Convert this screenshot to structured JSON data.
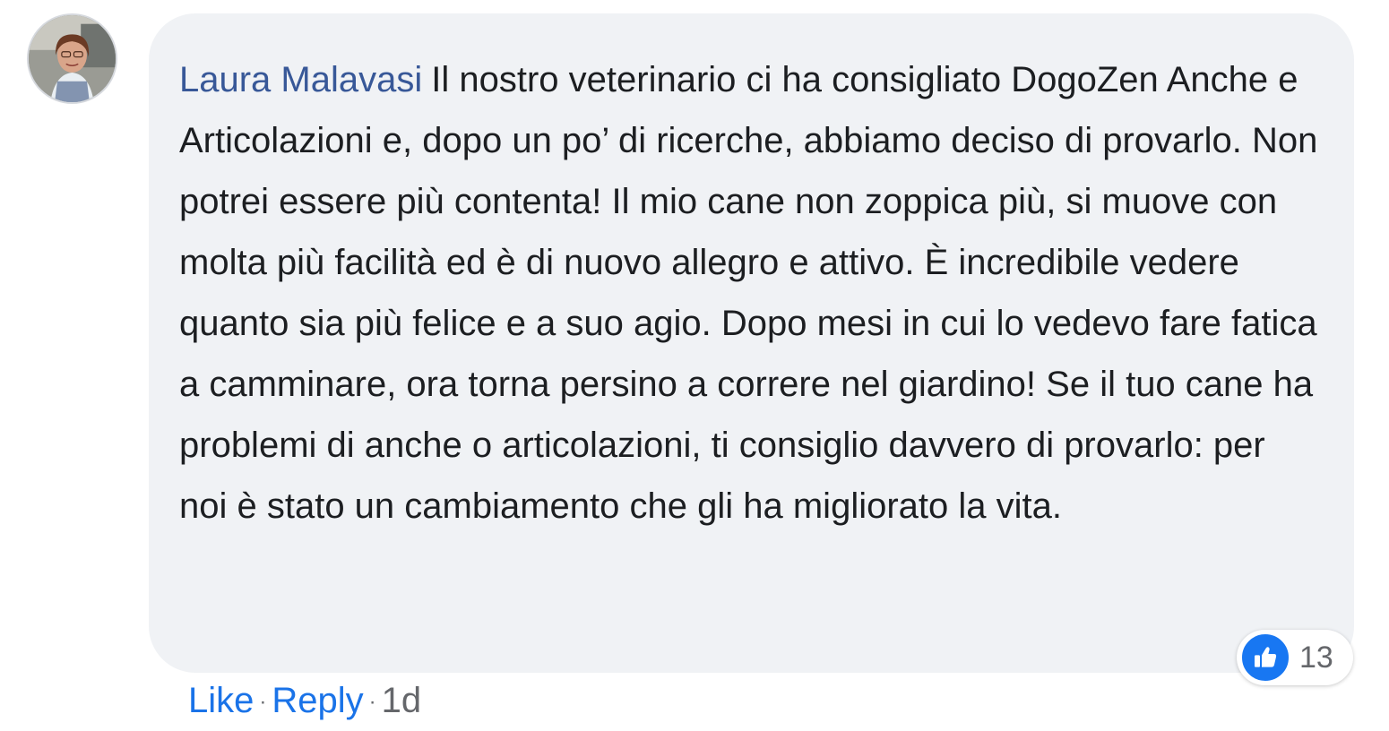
{
  "comment": {
    "author": "Laura Malavasi",
    "text": "Il nostro veterinario ci ha consigliato DogoZen Anche e Articolazioni e, dopo un po’ di ricerche, abbiamo deciso di provarlo. Non potrei essere più contenta! Il mio cane non zoppica più, si muove con molta più facilità ed è di nuovo allegro e attivo. È incredibile vedere quanto sia più felice e a suo agio. Dopo mesi in cui lo vedevo fare fatica a camminare, ora torna persino a correre nel giardino! Se il tuo cane ha problemi di anche o articolazioni, ti consiglio davvero di provarlo: per noi è stato un cambiamento che gli ha migliorato la vita."
  },
  "reactions": {
    "icon": "thumbs-up-icon",
    "count": "13"
  },
  "actions": {
    "like_label": "Like",
    "separator": "·",
    "reply_label": "Reply",
    "timestamp": "1d"
  },
  "colors": {
    "author": "#385898",
    "bubble": "#f0f2f5",
    "link": "#1a73e8",
    "like_badge": "#1877f2"
  }
}
